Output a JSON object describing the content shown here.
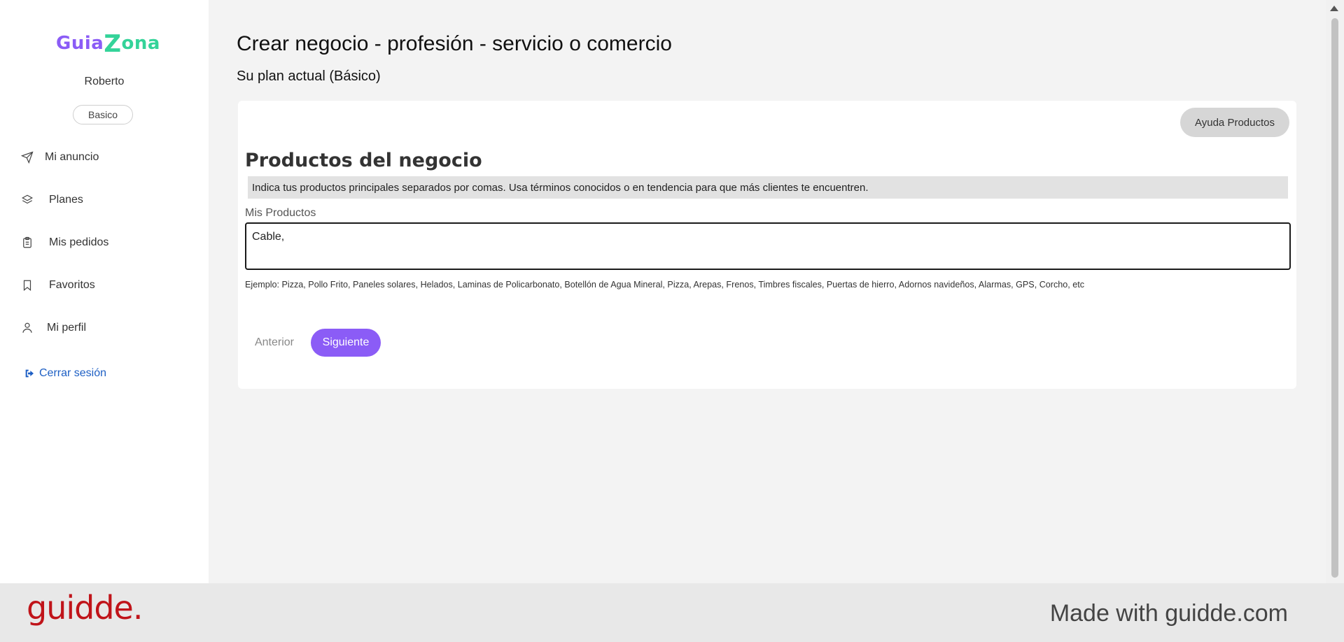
{
  "sidebar": {
    "logo": {
      "part1": "Guia",
      "z": "Z",
      "part2": "ona"
    },
    "user_name": "Roberto",
    "plan_badge": "Basico",
    "items": [
      {
        "label": "Mi anuncio",
        "icon": "send-icon"
      },
      {
        "label": "Planes",
        "icon": "layers-icon"
      },
      {
        "label": "Mis pedidos",
        "icon": "clipboard-icon"
      },
      {
        "label": "Favoritos",
        "icon": "bookmark-icon"
      },
      {
        "label": "Mi perfil",
        "icon": "user-icon"
      }
    ],
    "logout_label": "Cerrar sesión"
  },
  "main": {
    "title": "Crear negocio - profesión - servicio o comercio",
    "plan_line": "Su plan actual (Básico)",
    "card": {
      "help_button": "Ayuda Productos",
      "section_title": "Productos del negocio",
      "hint": "Indica tus productos principales separados por comas. Usa términos conocidos o en tendencia para que más clientes te encuentren.",
      "field_label": "Mis Productos",
      "field_value": "Cable, ",
      "example": "Ejemplo: Pizza, Pollo Frito, Paneles solares, Helados, Laminas de Policarbonato, Botellón de Agua Mineral, Pizza, Arepas, Frenos, Timbres fiscales, Puertas de hierro, Adornos navideños, Alarmas, GPS, Corcho, etc",
      "prev_button": "Anterior",
      "next_button": "Siguiente"
    }
  },
  "footer": {
    "brand": "guidde.",
    "made_with": "Made with guidde.com"
  },
  "colors": {
    "accent": "#8b5cf6",
    "logo_green": "#34d399",
    "link_blue": "#1d5fc4",
    "brand_red": "#c0141a"
  }
}
